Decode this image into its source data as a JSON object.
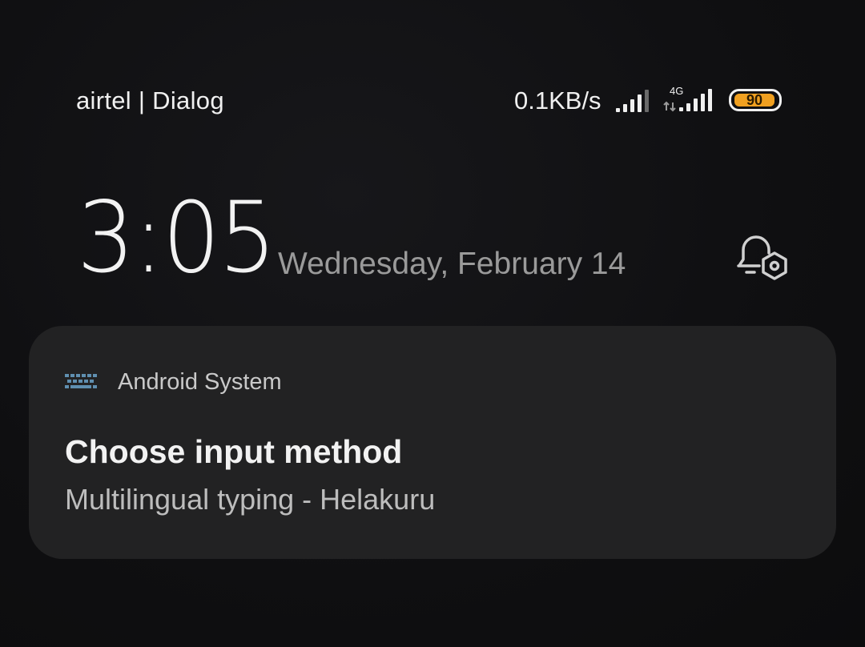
{
  "status_bar": {
    "carrier": "airtel | Dialog",
    "net_speed": "0.1KB/s",
    "network_type": "4G",
    "battery_level": "90",
    "colors": {
      "battery": "#f0a020",
      "text": "#f0f0f0"
    },
    "icons": [
      "signal-strength-icon",
      "signal-strength-4g-icon",
      "battery-icon"
    ]
  },
  "lock_screen": {
    "time": "3:05",
    "date": "Wednesday, February 14",
    "alarm_icon": "alarm-settings-icon"
  },
  "notification": {
    "app_icon": "keyboard-icon",
    "app_name": "Android System",
    "title": "Choose input method",
    "text": "Multilingual typing - Helakuru",
    "colors": {
      "card_background": "#222223",
      "keyboard_icon": "#5f8fb0"
    }
  }
}
